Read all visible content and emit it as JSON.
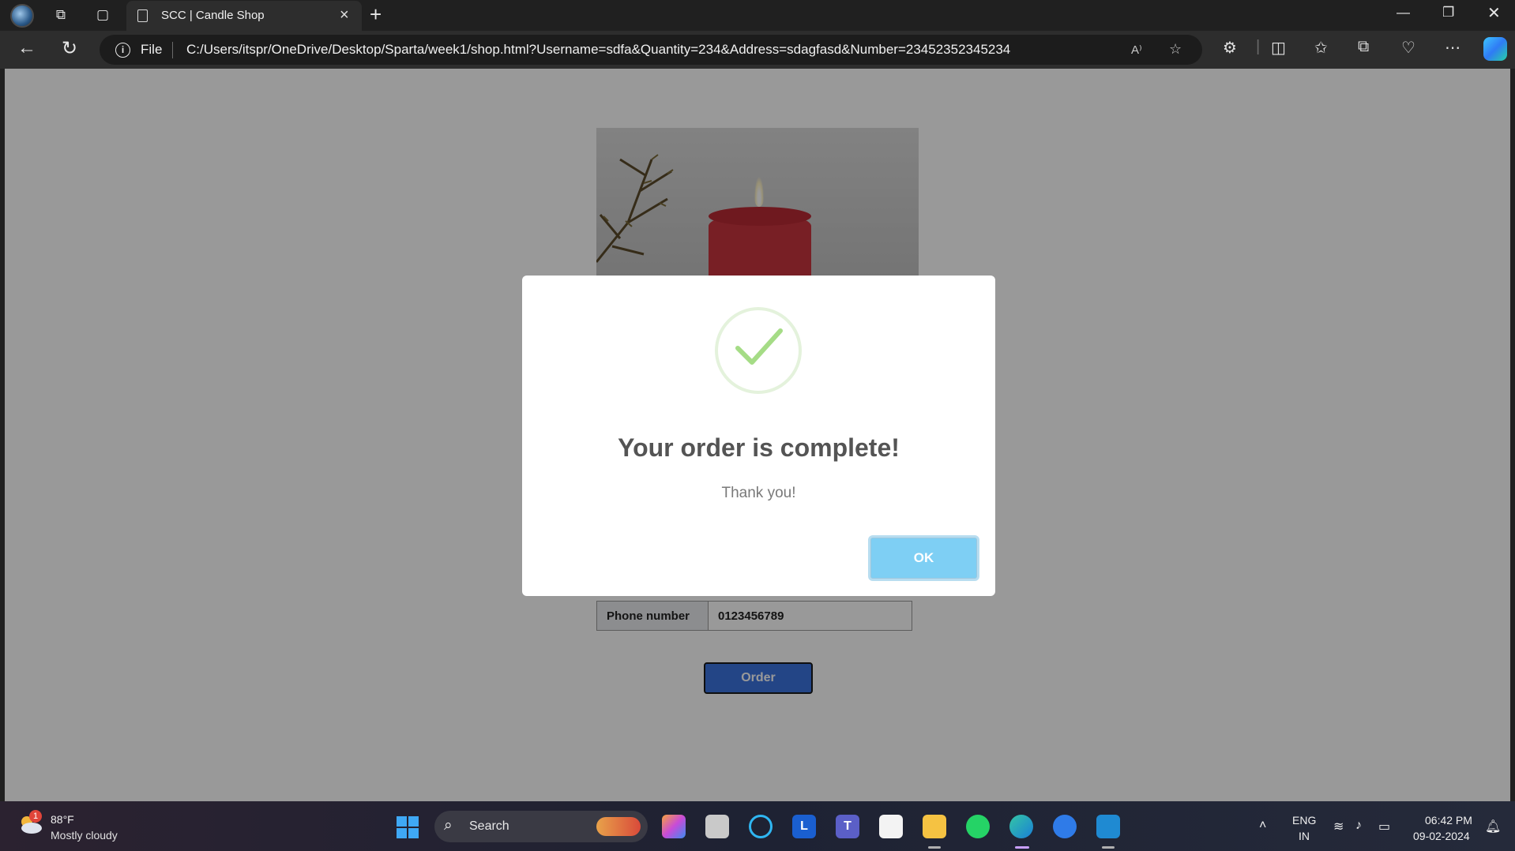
{
  "browser": {
    "tab_title": "SCC | Candle Shop",
    "new_tab_symbol": "+",
    "file_label": "File",
    "url": "C:/Users/itspr/OneDrive/Desktop/Sparta/week1/shop.html?Username=sdfa&Quantity=234&Address=sdagfasd&Number=23452352345234",
    "read_aloud_label": "A⁾"
  },
  "page": {
    "phone_label": "Phone number",
    "phone_value": "0123456789",
    "order_button": "Order"
  },
  "modal": {
    "title": "Your order is complete!",
    "message": "Thank you!",
    "ok_button": "OK",
    "check_color": "#a5dc86"
  },
  "taskbar": {
    "weather_badge": "1",
    "weather_temp": "88°F",
    "weather_desc": "Mostly cloudy",
    "search_label": "Search",
    "lang_primary": "ENG",
    "lang_region": "IN",
    "time": "06:42 PM",
    "date": "09-02-2024",
    "apps": [
      "copilot-pre",
      "task-view",
      "cortana",
      "l-app",
      "teams",
      "microsoft-store",
      "file-explorer",
      "whatsapp",
      "edge",
      "sync-app",
      "vscode"
    ]
  }
}
